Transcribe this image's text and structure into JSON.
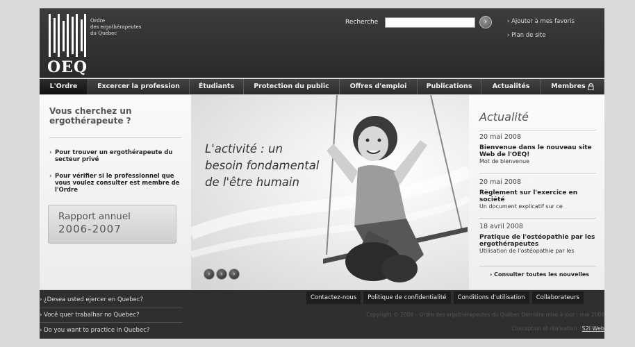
{
  "logo": {
    "lines": [
      "Ordre",
      "des ergothérapeutes",
      "du Québec"
    ],
    "acronym": "OEQ"
  },
  "header": {
    "search_label": "Recherche",
    "search_value": "",
    "search_button": "›",
    "links": [
      "› Ajouter à mes favoris",
      "› Plan de site"
    ]
  },
  "nav": {
    "items": [
      "L'Ordre",
      "Excercer la profession",
      "Étudiants",
      "Protection du public",
      "Offres d'emploi",
      "Publications",
      "Actualités",
      "Membres"
    ]
  },
  "left": {
    "title": "Vous cherchez un ergothérapeute ?",
    "links": [
      "Pour trouver un ergothérapeute du secteur privé",
      "Pour vérifier si le professionnel que vous voulez consulter est membre de l'Ordre"
    ],
    "rapport_line1": "Rapport annuel",
    "rapport_line2": "2006-2007"
  },
  "hero": {
    "headline": [
      "L'activité : un",
      "besoin fondamental",
      "de l'être humain"
    ],
    "dots": [
      "›",
      "›",
      "›"
    ]
  },
  "news": {
    "title": "Actualité",
    "items": [
      {
        "date": "20 mai 2008",
        "headline": "Bienvenue dans le nouveau site Web de l'OEQ!",
        "sub": "Mot de bienvenue"
      },
      {
        "date": "20 mai 2008",
        "headline": "Règlement sur l'exercice en société",
        "sub": "Un document explicatif sur ce"
      },
      {
        "date": "18 avril 2008",
        "headline": "Pratique de l'ostéopathie par les ergothérapeutes",
        "sub": "Utilisation de l'ostéopathie par les"
      }
    ],
    "all_link": "Consulter toutes les nouvelles"
  },
  "footer": {
    "lang_links": [
      "› ¿Desea usted ejercer en Quebec?",
      "› Você quer trabalhar no Quebec?",
      "› Do you want to practice in Quebec?"
    ],
    "links": [
      "Contactez-nous",
      "Politique de confidentialité",
      "Conditions d'utilisation",
      "Collaborateurs"
    ],
    "copyright": "Copyright © 2008 – Ordre des ergothérapeutes du Québec   Dernière mise à jour : mai 2008",
    "credits_prefix": "Conception et réalisation : ",
    "credits_link": "S2i Web"
  }
}
